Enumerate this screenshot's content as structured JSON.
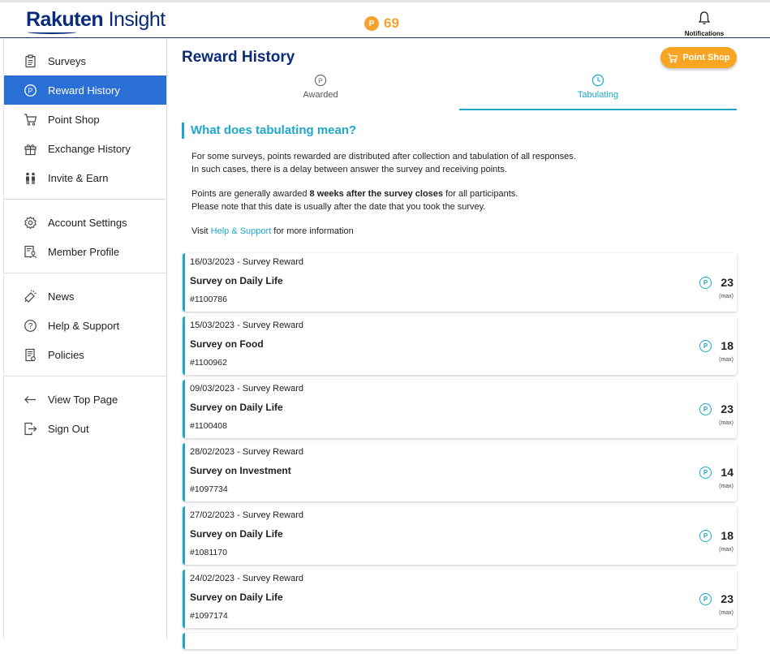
{
  "header": {
    "logo_text_bold": "Rakuten",
    "logo_text": " Insight",
    "points_icon": "P",
    "points_value": "69",
    "notifications_label": "Notifications"
  },
  "sidebar": {
    "groups": [
      [
        {
          "label": "Surveys",
          "icon": "clipboard-icon"
        },
        {
          "label": "Reward History",
          "icon": "points-icon",
          "active": true
        },
        {
          "label": "Point Shop",
          "icon": "cart-icon"
        },
        {
          "label": "Exchange History",
          "icon": "gift-icon"
        },
        {
          "label": "Invite & Earn",
          "icon": "people-icon"
        }
      ],
      [
        {
          "label": "Account Settings",
          "icon": "gear-icon"
        },
        {
          "label": "Member Profile",
          "icon": "profile-icon"
        }
      ],
      [
        {
          "label": "News",
          "icon": "megaphone-icon"
        },
        {
          "label": "Help & Support",
          "icon": "help-icon"
        },
        {
          "label": "Policies",
          "icon": "document-icon"
        }
      ],
      [
        {
          "label": "View Top Page",
          "icon": "arrow-left-icon"
        },
        {
          "label": "Sign Out",
          "icon": "sign-out-icon"
        }
      ]
    ]
  },
  "main": {
    "title": "Reward History",
    "point_shop_button": "Point Shop",
    "tabs": [
      {
        "label": "Awarded",
        "icon": "points-icon"
      },
      {
        "label": "Tabulating",
        "icon": "clock-icon",
        "active": true
      }
    ],
    "info_title": "What does tabulating mean?",
    "info": {
      "p1_line1": "For some surveys, points rewarded are distributed after collection and tabulation of all responses.",
      "p1_line2": "In such cases, there is a delay between answer the survey and receiving points.",
      "p2_pre": "Points are generally awarded ",
      "p2_bold": "8 weeks after the survey closes",
      "p2_post": " for all participants.",
      "p2_line2": "Please note that this date is usually after the date that you took the survey.",
      "p3_pre": "Visit ",
      "p3_link": "Help & Support",
      "p3_post": " for more information"
    },
    "rewards": [
      {
        "date": "16/03/2023 - Survey Reward",
        "title": "Survey on Daily Life",
        "id": "#1100786",
        "points": "23",
        "max": "(max)"
      },
      {
        "date": "15/03/2023 - Survey Reward",
        "title": "Survey on Food",
        "id": "#1100962",
        "points": "18",
        "max": "(max)"
      },
      {
        "date": "09/03/2023 - Survey Reward",
        "title": "Survey on Daily Life",
        "id": "#1100408",
        "points": "23",
        "max": "(max)"
      },
      {
        "date": "28/02/2023 - Survey Reward",
        "title": "Survey on Investment",
        "id": "#1097734",
        "points": "14",
        "max": "(max)"
      },
      {
        "date": "27/02/2023 - Survey Reward",
        "title": "Survey on Daily Life",
        "id": "#1081170",
        "points": "18",
        "max": "(max)"
      },
      {
        "date": "24/02/2023 - Survey Reward",
        "title": "Survey on Daily Life",
        "id": "#1097174",
        "points": "23",
        "max": "(max)"
      }
    ],
    "point_icon_letter": "P"
  },
  "colors": {
    "brand": "#0a2a7a",
    "accent": "#1fa7c9",
    "active_nav": "#2a6fd6",
    "points_orange": "#f4a32e"
  }
}
